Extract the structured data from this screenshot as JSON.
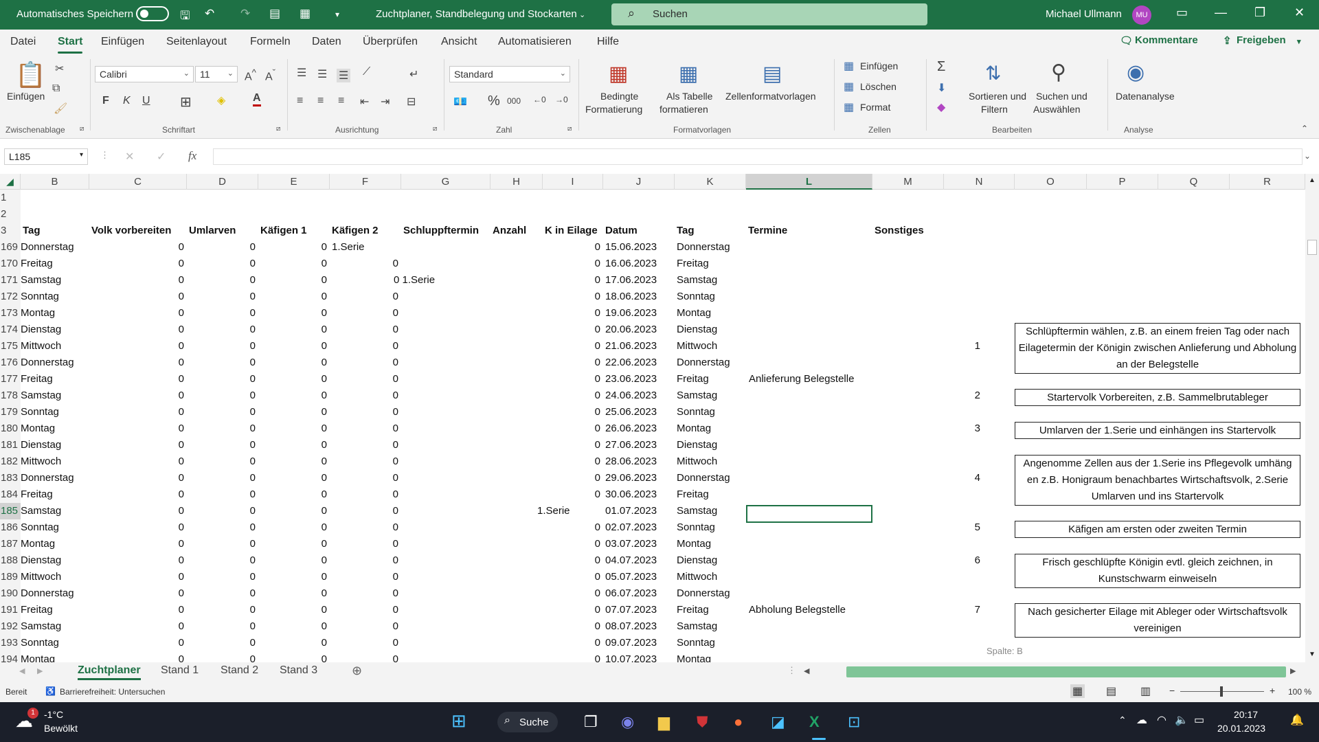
{
  "titlebar": {
    "autosave_label": "Automatisches Speichern",
    "doc_title": "Zuchtplaner, Standbelegung und Stockarten",
    "search_placeholder": "Suchen",
    "user_name": "Michael Ullmann",
    "user_initials": "MU"
  },
  "menu": {
    "items": [
      "Datei",
      "Start",
      "Einfügen",
      "Seitenlayout",
      "Formeln",
      "Daten",
      "Überprüfen",
      "Ansicht",
      "Automatisieren",
      "Hilfe"
    ],
    "comments": "Kommentare",
    "share": "Freigeben"
  },
  "ribbon": {
    "paste": "Einfügen",
    "grp_clipboard": "Zwischenablage",
    "font_name": "Calibri",
    "font_size": "11",
    "grp_font": "Schriftart",
    "grp_align": "Ausrichtung",
    "number_format": "Standard",
    "grp_number": "Zahl",
    "cond_format_1": "Bedingte",
    "cond_format_2": "Formatierung",
    "as_table_1": "Als Tabelle",
    "as_table_2": "formatieren",
    "cell_styles": "Zellenformatvorlagen",
    "grp_styles": "Formatvorlagen",
    "insert": "Einfügen",
    "delete": "Löschen",
    "format": "Format",
    "grp_cells": "Zellen",
    "sort_1": "Sortieren und",
    "sort_2": "Filtern",
    "find_1": "Suchen und",
    "find_2": "Auswählen",
    "grp_edit": "Bearbeiten",
    "analysis": "Datenanalyse",
    "grp_analysis": "Analyse",
    "bold": "F",
    "italic": "K",
    "underline": "U"
  },
  "formula": {
    "namebox": "L185",
    "fx": "fx",
    "content": ""
  },
  "columns": [
    "B",
    "C",
    "D",
    "E",
    "F",
    "G",
    "H",
    "I",
    "J",
    "K",
    "L",
    "M",
    "N",
    "O",
    "P",
    "Q",
    "R"
  ],
  "header_row": {
    "num": "3",
    "B": "Tag",
    "C": "Volk vorbereiten",
    "D": "Umlarven",
    "E": "Käfigen 1",
    "F": "Käfigen 2",
    "G": "Schluppftermin",
    "H": "Anzahl",
    "I": "K in Eilage",
    "J": "Datum",
    "K": "Tag",
    "L": "Termine",
    "M": "Sonstiges"
  },
  "rows": [
    {
      "n": "169",
      "b": "Donnerstag",
      "c": "0",
      "d": "0",
      "e": "0",
      "f": "1.Serie",
      "g": "",
      "i": "0",
      "j": "15.06.2023",
      "k": "Donnerstag",
      "l": "",
      "nn": ""
    },
    {
      "n": "170",
      "b": "Freitag",
      "c": "0",
      "d": "0",
      "e": "0",
      "f": "",
      "g": "0",
      "i": "0",
      "j": "16.06.2023",
      "k": "Freitag",
      "l": "",
      "nn": ""
    },
    {
      "n": "171",
      "b": "Samstag",
      "c": "0",
      "d": "0",
      "e": "0",
      "f": "",
      "g": "0 1.Serie",
      "i": "0",
      "j": "17.06.2023",
      "k": "Samstag",
      "l": "",
      "nn": ""
    },
    {
      "n": "172",
      "b": "Sonntag",
      "c": "0",
      "d": "0",
      "e": "0",
      "f": "",
      "g": "0",
      "i": "0",
      "j": "18.06.2023",
      "k": "Sonntag",
      "l": "",
      "nn": ""
    },
    {
      "n": "173",
      "b": "Montag",
      "c": "0",
      "d": "0",
      "e": "0",
      "f": "",
      "g": "0",
      "i": "0",
      "j": "19.06.2023",
      "k": "Montag",
      "l": "",
      "nn": ""
    },
    {
      "n": "174",
      "b": "Dienstag",
      "c": "0",
      "d": "0",
      "e": "0",
      "f": "",
      "g": "0",
      "i": "0",
      "j": "20.06.2023",
      "k": "Dienstag",
      "l": "",
      "nn": ""
    },
    {
      "n": "175",
      "b": "Mittwoch",
      "c": "0",
      "d": "0",
      "e": "0",
      "f": "",
      "g": "0",
      "i": "0",
      "j": "21.06.2023",
      "k": "Mittwoch",
      "l": "",
      "nn": "1"
    },
    {
      "n": "176",
      "b": "Donnerstag",
      "c": "0",
      "d": "0",
      "e": "0",
      "f": "",
      "g": "0",
      "i": "0",
      "j": "22.06.2023",
      "k": "Donnerstag",
      "l": "",
      "nn": ""
    },
    {
      "n": "177",
      "b": "Freitag",
      "c": "0",
      "d": "0",
      "e": "0",
      "f": "",
      "g": "0",
      "i": "0",
      "j": "23.06.2023",
      "k": "Freitag",
      "l": "Anlieferung Belegstelle",
      "nn": ""
    },
    {
      "n": "178",
      "b": "Samstag",
      "c": "0",
      "d": "0",
      "e": "0",
      "f": "",
      "g": "0",
      "i": "0",
      "j": "24.06.2023",
      "k": "Samstag",
      "l": "",
      "nn": "2"
    },
    {
      "n": "179",
      "b": "Sonntag",
      "c": "0",
      "d": "0",
      "e": "0",
      "f": "",
      "g": "0",
      "i": "0",
      "j": "25.06.2023",
      "k": "Sonntag",
      "l": "",
      "nn": ""
    },
    {
      "n": "180",
      "b": "Montag",
      "c": "0",
      "d": "0",
      "e": "0",
      "f": "",
      "g": "0",
      "i": "0",
      "j": "26.06.2023",
      "k": "Montag",
      "l": "",
      "nn": "3"
    },
    {
      "n": "181",
      "b": "Dienstag",
      "c": "0",
      "d": "0",
      "e": "0",
      "f": "",
      "g": "0",
      "i": "0",
      "j": "27.06.2023",
      "k": "Dienstag",
      "l": "",
      "nn": ""
    },
    {
      "n": "182",
      "b": "Mittwoch",
      "c": "0",
      "d": "0",
      "e": "0",
      "f": "",
      "g": "0",
      "i": "0",
      "j": "28.06.2023",
      "k": "Mittwoch",
      "l": "",
      "nn": ""
    },
    {
      "n": "183",
      "b": "Donnerstag",
      "c": "0",
      "d": "0",
      "e": "0",
      "f": "",
      "g": "0",
      "i": "0",
      "j": "29.06.2023",
      "k": "Donnerstag",
      "l": "",
      "nn": "4"
    },
    {
      "n": "184",
      "b": "Freitag",
      "c": "0",
      "d": "0",
      "e": "0",
      "f": "",
      "g": "0",
      "i": "0",
      "j": "30.06.2023",
      "k": "Freitag",
      "l": "",
      "nn": ""
    },
    {
      "n": "185",
      "b": "Samstag",
      "c": "0",
      "d": "0",
      "e": "0",
      "f": "",
      "g": "0",
      "i": "1.Serie",
      "j": "01.07.2023",
      "k": "Samstag",
      "l": "",
      "nn": ""
    },
    {
      "n": "186",
      "b": "Sonntag",
      "c": "0",
      "d": "0",
      "e": "0",
      "f": "",
      "g": "0",
      "i": "0",
      "j": "02.07.2023",
      "k": "Sonntag",
      "l": "",
      "nn": "5"
    },
    {
      "n": "187",
      "b": "Montag",
      "c": "0",
      "d": "0",
      "e": "0",
      "f": "",
      "g": "0",
      "i": "0",
      "j": "03.07.2023",
      "k": "Montag",
      "l": "",
      "nn": ""
    },
    {
      "n": "188",
      "b": "Dienstag",
      "c": "0",
      "d": "0",
      "e": "0",
      "f": "",
      "g": "0",
      "i": "0",
      "j": "04.07.2023",
      "k": "Dienstag",
      "l": "",
      "nn": "6"
    },
    {
      "n": "189",
      "b": "Mittwoch",
      "c": "0",
      "d": "0",
      "e": "0",
      "f": "",
      "g": "0",
      "i": "0",
      "j": "05.07.2023",
      "k": "Mittwoch",
      "l": "",
      "nn": ""
    },
    {
      "n": "190",
      "b": "Donnerstag",
      "c": "0",
      "d": "0",
      "e": "0",
      "f": "",
      "g": "0",
      "i": "0",
      "j": "06.07.2023",
      "k": "Donnerstag",
      "l": "",
      "nn": ""
    },
    {
      "n": "191",
      "b": "Freitag",
      "c": "0",
      "d": "0",
      "e": "0",
      "f": "",
      "g": "0",
      "i": "0",
      "j": "07.07.2023",
      "k": "Freitag",
      "l": "Abholung Belegstelle",
      "nn": "7"
    },
    {
      "n": "192",
      "b": "Samstag",
      "c": "0",
      "d": "0",
      "e": "0",
      "f": "",
      "g": "0",
      "i": "0",
      "j": "08.07.2023",
      "k": "Samstag",
      "l": "",
      "nn": ""
    },
    {
      "n": "193",
      "b": "Sonntag",
      "c": "0",
      "d": "0",
      "e": "0",
      "f": "",
      "g": "0",
      "i": "0",
      "j": "09.07.2023",
      "k": "Sonntag",
      "l": "",
      "nn": ""
    },
    {
      "n": "194",
      "b": "Montag",
      "c": "0",
      "d": "0",
      "e": "0",
      "f": "",
      "g": "0",
      "i": "0",
      "j": "10.07.2023",
      "k": "Montag",
      "l": "",
      "nn": ""
    }
  ],
  "notes": [
    "Schlüpftermin wählen, z.B. an einem freien Tag oder nach Eilagetermin der Königin zwischen Anlieferung und Abholung an der Belegstelle",
    "Startervolk Vorbereiten, z.B. Sammelbrutableger",
    "Umlarven der 1.Serie und einhängen ins Startervolk",
    "Angenomme Zellen aus der 1.Serie ins Pflegevolk umhäng en z.B. Honigraum benachbartes Wirtschaftsvolk, 2.Serie Umlarven und ins Startervolk",
    "Käfigen am ersten oder zweiten Termin",
    "Frisch geschlüpfte Königin evtl. gleich zeichnen, in Kunstschwarm einweiseln",
    "Nach gesicherter Eilage mit Ableger oder Wirtschaftsvolk vereinigen"
  ],
  "tooltip": "Spalte: B",
  "sheets": {
    "tabs": [
      "Zuchtplaner",
      "Stand 1",
      "Stand 2",
      "Stand 3"
    ]
  },
  "status": {
    "ready": "Bereit",
    "accessibility": "Barrierefreiheit: Untersuchen",
    "zoom": "100 %"
  },
  "taskbar": {
    "temp": "-1°C",
    "weather": "Bewölkt",
    "weather_badge": "1",
    "search": "Suche",
    "time": "20:17",
    "date": "20.01.2023"
  },
  "colors": {
    "accent": "#1e7145",
    "taskbar": "#1b1f2a"
  }
}
